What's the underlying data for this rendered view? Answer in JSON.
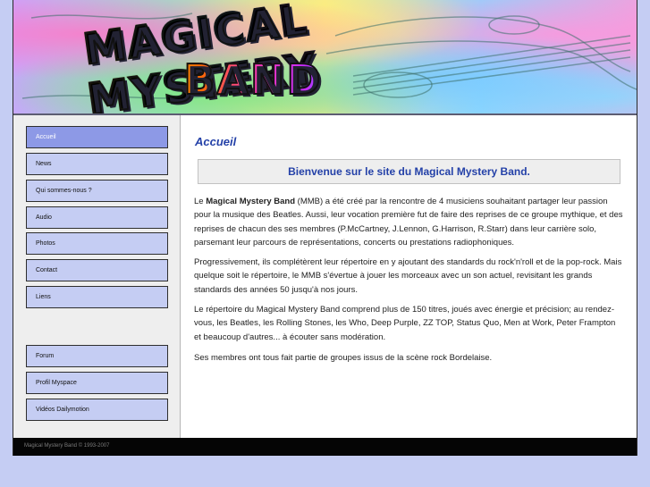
{
  "banner": {
    "logo_line1": "MAGICAL MYSTERY",
    "logo_line2": "BAND"
  },
  "sidebar": {
    "items": [
      {
        "label": "Accueil",
        "active": true
      },
      {
        "label": "News"
      },
      {
        "label": "Qui sommes-nous ?"
      },
      {
        "label": "Audio"
      },
      {
        "label": "Photos"
      },
      {
        "label": "Contact"
      },
      {
        "label": "Liens"
      }
    ],
    "external": [
      {
        "label": "Forum"
      },
      {
        "label": "Profil Myspace"
      },
      {
        "label": "Vidéos Dailymotion"
      }
    ]
  },
  "main": {
    "title": "Accueil",
    "welcome": "Bienvenue sur le site du Magical Mystery Band.",
    "p1": {
      "prefix": "Le ",
      "band_name": "Magical Mystery Band",
      "text": " (MMB) a été créé par la rencontre de 4 musiciens souhaitant partager leur passion pour la musique des Beatles. Aussi, leur vocation première fut de faire des reprises de ce groupe mythique, et des reprises de chacun des ses membres (P.McCartney, J.Lennon, G.Harrison, R.Starr) dans leur carrière solo, parsemant leur parcours de représentations, concerts ou prestations radiophoniques."
    },
    "p2": "Progressivement, ils complétèrent leur répertoire en y ajoutant des standards du rock'n'roll et de la pop-rock. Mais quelque soit le répertoire, le MMB s'évertue à jouer les morceaux avec un son actuel, revisitant les grands standards des années 50 jusqu'à nos jours.",
    "p3": "Le répertoire du Magical Mystery Band comprend plus de 150 titres, joués avec énergie et précision; au rendez-vous, les Beatles, les Rolling Stones, les Who, Deep Purple, ZZ TOP, Status Quo, Men at Work, Peter Frampton et beaucoup d'autres... à écouter sans modération.",
    "p4": "Ses membres ont tous fait partie de groupes issus de la scène rock Bordelaise."
  },
  "footer": {
    "text": "Magical Mystery Band © 1993-2007"
  },
  "colors": {
    "page_bg": "#c5cdf3",
    "nav_bg": "#c5cdf3",
    "nav_active": "#8d99e6",
    "title_blue": "#2441a8",
    "footer_bg": "#050505"
  }
}
